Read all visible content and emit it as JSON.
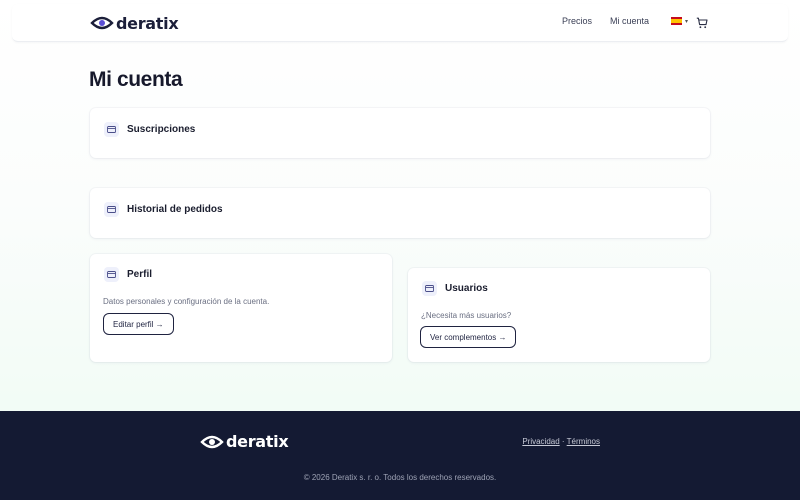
{
  "brand": {
    "name": "deratix",
    "logo_icon": "eye-logo-icon"
  },
  "header": {
    "nav": [
      {
        "label": "Precios"
      },
      {
        "label": "Mi cuenta"
      }
    ],
    "language_icon": "spain-flag-icon",
    "cart_icon": "cart-icon"
  },
  "page": {
    "title": "Mi cuenta"
  },
  "cards": {
    "subscriptions": {
      "title": "Suscripciones",
      "icon": "card-icon"
    },
    "orders": {
      "title": "Historial de pedidos",
      "icon": "card-icon"
    },
    "profile": {
      "title": "Perfil",
      "icon": "card-icon",
      "description": "Datos personales y configuración de la cuenta.",
      "button": "Editar perfil →"
    },
    "users": {
      "title": "Usuarios",
      "icon": "card-icon",
      "description": "¿Necesita más usuarios?",
      "button": "Ver complementos →"
    }
  },
  "footer": {
    "links": [
      {
        "label": "Privacidad"
      },
      {
        "label": "Términos"
      }
    ],
    "separator": " · ",
    "copyright": "© 2026 Deratix s. r. o. Todos los derechos reservados."
  },
  "colors": {
    "primary": "#1c1f3a",
    "footer_bg": "#141a33",
    "icon_bg": "#eef0fb",
    "accent": "#5b4fd6"
  }
}
